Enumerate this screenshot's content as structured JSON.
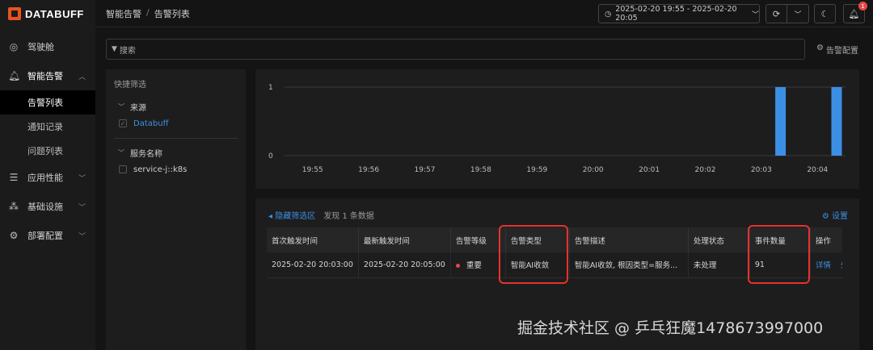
{
  "app": {
    "logo_text": "DATABUFF"
  },
  "sidebar": {
    "items": [
      {
        "label": "驾驶舱",
        "icon": "cockpit-icon"
      },
      {
        "label": "智能告警",
        "icon": "bell-icon",
        "open": true,
        "children": [
          {
            "label": "告警列表",
            "active": true
          },
          {
            "label": "通知记录"
          },
          {
            "label": "问题列表"
          }
        ]
      },
      {
        "label": "应用性能",
        "icon": "app-performance-icon"
      },
      {
        "label": "基础设施",
        "icon": "infrastructure-icon"
      },
      {
        "label": "部署配置",
        "icon": "gear-icon"
      }
    ]
  },
  "header": {
    "breadcrumb": [
      "智能告警",
      "告警列表"
    ],
    "time_range": "2025-02-20 19:55 - 2025-02-20 20:05",
    "notification_count": "1"
  },
  "search": {
    "placeholder": "搜索",
    "config_label": "告警配置"
  },
  "filters": {
    "title": "快捷筛选",
    "groups": [
      {
        "label": "来源",
        "options": [
          {
            "label": "Databuff",
            "checked": true
          }
        ]
      },
      {
        "label": "服务名称",
        "options": [
          {
            "label": "service-j::k8s",
            "checked": false
          }
        ]
      }
    ]
  },
  "chart_data": {
    "type": "bar",
    "categories": [
      "19:55",
      "19:56",
      "19:57",
      "19:58",
      "19:59",
      "20:00",
      "20:01",
      "20:02",
      "20:03",
      "20:04"
    ],
    "values": [
      0,
      0,
      0,
      0,
      0,
      0,
      0,
      0,
      1,
      1
    ],
    "ylim": [
      0,
      1
    ],
    "yticks": [
      "0",
      "1"
    ],
    "bar_color": "#3b8fe4",
    "grid": true
  },
  "list": {
    "hide_filters_label": "隐藏筛选区",
    "found_text": "发现 1 条数据",
    "settings_label": "设置",
    "columns": [
      "首次触发时间",
      "最新触发时间",
      "告警等级",
      "告警类型",
      "告警描述",
      "处理状态",
      "事件数量",
      "操作"
    ],
    "rows": [
      {
        "first_time": "2025-02-20 20:03:00",
        "latest_time": "2025-02-20 20:05:00",
        "level": "重要",
        "type": "智能AI收敛",
        "description": "智能AI收敛, 根因类型=服务...",
        "status": "未处理",
        "event_count": "91",
        "actions": [
          "详情",
          "处"
        ]
      }
    ]
  },
  "watermark": "掘金技术社区 @ 乒乓狂魔1478673997000",
  "colors": {
    "accent": "#3c8fe3",
    "highlight": "#e5322d",
    "danger": "#e84749",
    "brand": "#e8531f"
  }
}
